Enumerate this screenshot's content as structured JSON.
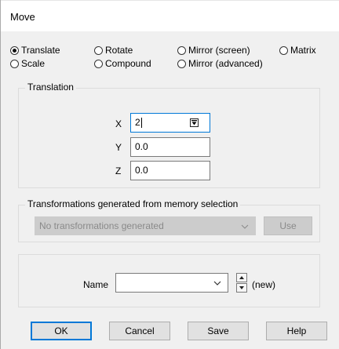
{
  "window": {
    "title": "Move"
  },
  "mode_options": [
    {
      "label": "Translate",
      "selected": true
    },
    {
      "label": "Rotate",
      "selected": false
    },
    {
      "label": "Mirror (screen)",
      "selected": false
    },
    {
      "label": "Matrix",
      "selected": false
    },
    {
      "label": "Scale",
      "selected": false
    },
    {
      "label": "Compound",
      "selected": false
    },
    {
      "label": "Mirror (advanced)",
      "selected": false
    }
  ],
  "translation": {
    "group_label": "Translation",
    "x": {
      "label": "X",
      "value": "2"
    },
    "y": {
      "label": "Y",
      "value": "0.0"
    },
    "z": {
      "label": "Z",
      "value": "0.0"
    }
  },
  "memory": {
    "group_label": "Transformations generated from memory selection",
    "combo_value": "No transformations generated",
    "use_label": "Use"
  },
  "name_row": {
    "label": "Name",
    "value": "",
    "status": "(new)"
  },
  "buttons": {
    "ok": "OK",
    "cancel": "Cancel",
    "save": "Save",
    "help": "Help"
  },
  "colors": {
    "accent": "#0078d7",
    "dialog_bg": "#f0f0f0",
    "disabled_bg": "#cccccc"
  }
}
